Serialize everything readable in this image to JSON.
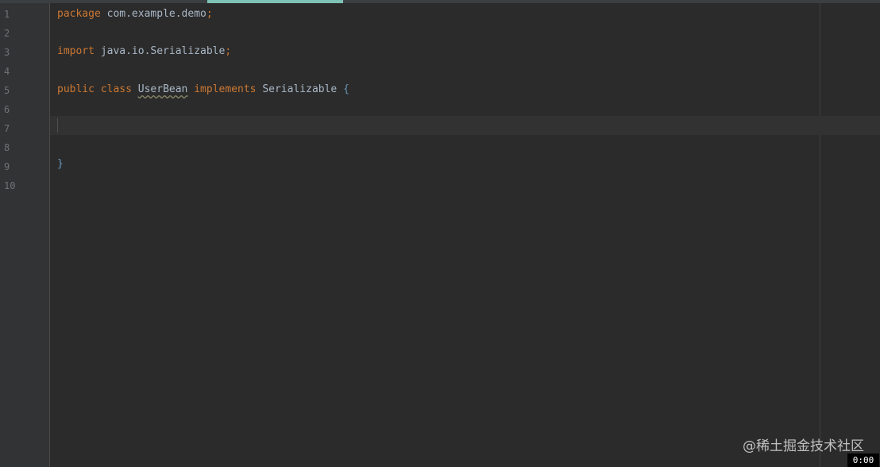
{
  "editor": {
    "line_numbers": [
      "1",
      "2",
      "3",
      "4",
      "5",
      "6",
      "7",
      "8",
      "9",
      "10"
    ],
    "lines": {
      "line1": {
        "kw": "package",
        "rest": " com.example.demo",
        "punct": ";"
      },
      "line3": {
        "kw": "import",
        "rest": " java.io.Serializable",
        "punct": ";"
      },
      "line5": {
        "kw_public": "public",
        "kw_class": "class",
        "class_name": "UserBean",
        "kw_implements": "implements",
        "interface_name": "Serializable",
        "open_brace": "{"
      },
      "line9": {
        "close_brace": "}"
      }
    },
    "colors": {
      "background": "#2b2b2b",
      "gutter": "#313335",
      "keyword": "#cc7832",
      "text": "#a9b7c6",
      "brace": "#6897bb",
      "tab_indicator": "#7ec3b6"
    }
  },
  "overlay": {
    "watermark": "@稀土掘金技术社区",
    "time_badge": "0:00"
  }
}
